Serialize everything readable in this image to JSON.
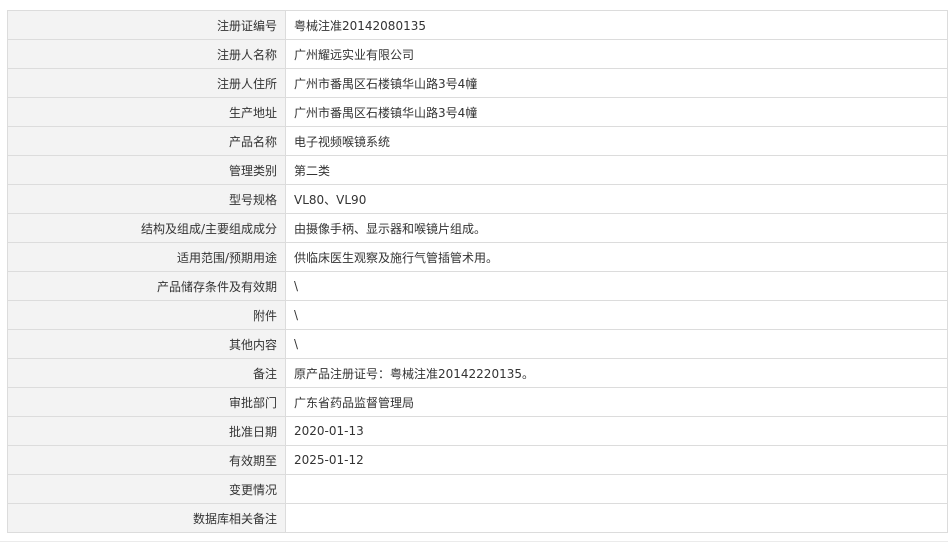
{
  "rows": [
    {
      "label": "注册证编号",
      "value": "粤械注准20142080135"
    },
    {
      "label": "注册人名称",
      "value": "广州耀远实业有限公司"
    },
    {
      "label": "注册人住所",
      "value": "广州市番禺区石楼镇华山路3号4幢"
    },
    {
      "label": "生产地址",
      "value": "广州市番禺区石楼镇华山路3号4幢"
    },
    {
      "label": "产品名称",
      "value": "电子视频喉镜系统"
    },
    {
      "label": "管理类别",
      "value": "第二类"
    },
    {
      "label": "型号规格",
      "value": "VL80、VL90"
    },
    {
      "label": "结构及组成/主要组成成分",
      "value": "由摄像手柄、显示器和喉镜片组成。"
    },
    {
      "label": "适用范围/预期用途",
      "value": "供临床医生观察及施行气管插管术用。"
    },
    {
      "label": "产品储存条件及有效期",
      "value": "\\"
    },
    {
      "label": "附件",
      "value": "\\"
    },
    {
      "label": "其他内容",
      "value": "\\"
    },
    {
      "label": "备注",
      "value": "原产品注册证号：粤械注准20142220135。"
    },
    {
      "label": "审批部门",
      "value": "广东省药品监督管理局"
    },
    {
      "label": "批准日期",
      "value": "2020-01-13"
    },
    {
      "label": "有效期至",
      "value": "2025-01-12"
    },
    {
      "label": "变更情况",
      "value": ""
    },
    {
      "label": "数据库相关备注",
      "value": ""
    }
  ]
}
